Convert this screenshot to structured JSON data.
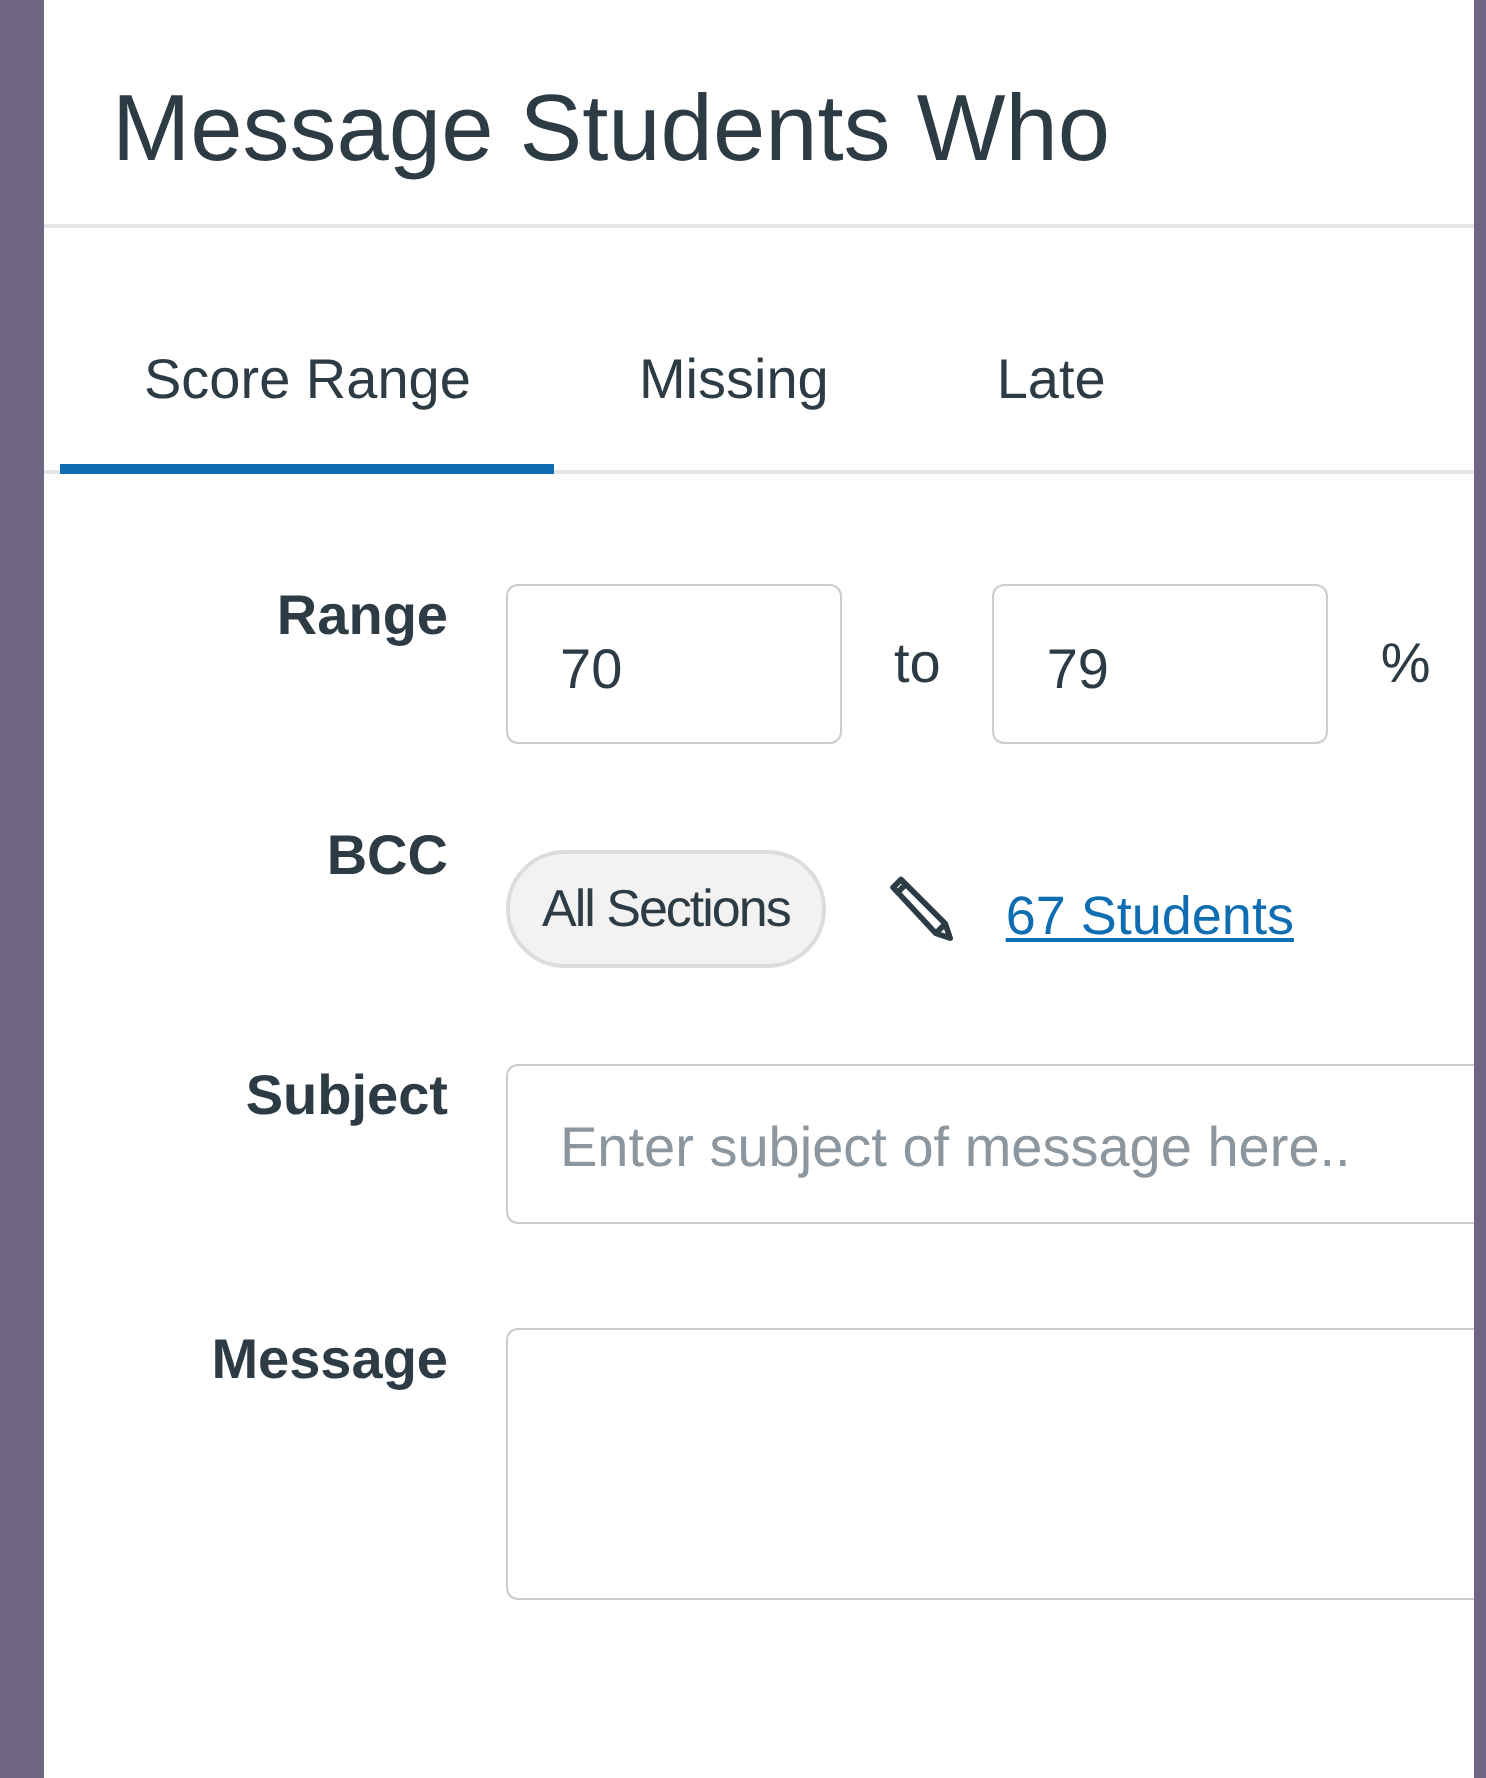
{
  "dialog": {
    "title": "Message Students Who"
  },
  "tabs": [
    {
      "label": "Score Range",
      "selected": true
    },
    {
      "label": "Missing",
      "selected": false
    },
    {
      "label": "Late",
      "selected": false
    }
  ],
  "range": {
    "label": "Range",
    "from": "70",
    "separator": "to",
    "to": "79",
    "unit": "%"
  },
  "bcc": {
    "label": "BCC",
    "chip": "All Sections",
    "link": "67 Students"
  },
  "subject": {
    "label": "Subject",
    "placeholder": "Enter subject of message here.."
  },
  "message": {
    "label": "Message"
  }
}
